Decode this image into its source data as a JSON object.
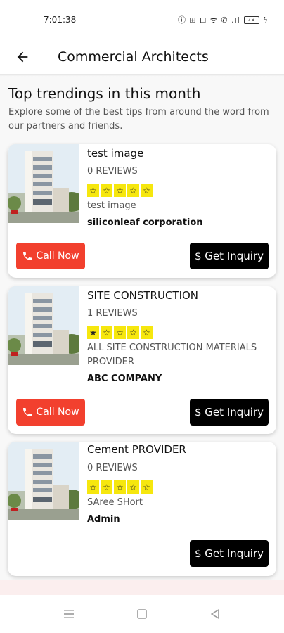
{
  "status_bar": {
    "time": "7:01:38",
    "icons_text": "ⓘ ⊞ ⊟ ᯤ ✆ .ıl",
    "battery": "79"
  },
  "app_bar": {
    "back_icon": "arrow-left-icon",
    "title": "Commercial Architects"
  },
  "section": {
    "title": "Top trendings in this month",
    "subtitle": "Explore some of the best tips from around the word from our partners and friends."
  },
  "listings": [
    {
      "title": "test image",
      "reviews": "0 REVIEWS",
      "rating": 0,
      "description": "test image",
      "company": "siliconleaf corporation",
      "call_label": "Call Now",
      "inquiry_label": "$ Get Inquiry"
    },
    {
      "title": "SITE CONSTRUCTION",
      "reviews": "1 REVIEWS",
      "rating": 1,
      "description": "ALL SITE CONSTRUCTION MATERIALS  PROVIDER",
      "company": "ABC COMPANY",
      "call_label": "Call Now",
      "inquiry_label": "$ Get Inquiry"
    },
    {
      "title": "Cement PROVIDER",
      "reviews": "0 REVIEWS",
      "rating": 0,
      "description": "SAree SHort",
      "company": "Admin",
      "inquiry_label": "$ Get Inquiry"
    }
  ],
  "star_symbols": {
    "filled": "★",
    "empty": "☆"
  },
  "colors": {
    "call_button": "#f2402e",
    "inquiry_button": "#000000",
    "star_background": "#f6e70e"
  },
  "nav_bar": {
    "menu_icon": "menu-icon",
    "home_icon": "square-home-icon",
    "back_icon": "triangle-back-icon"
  }
}
